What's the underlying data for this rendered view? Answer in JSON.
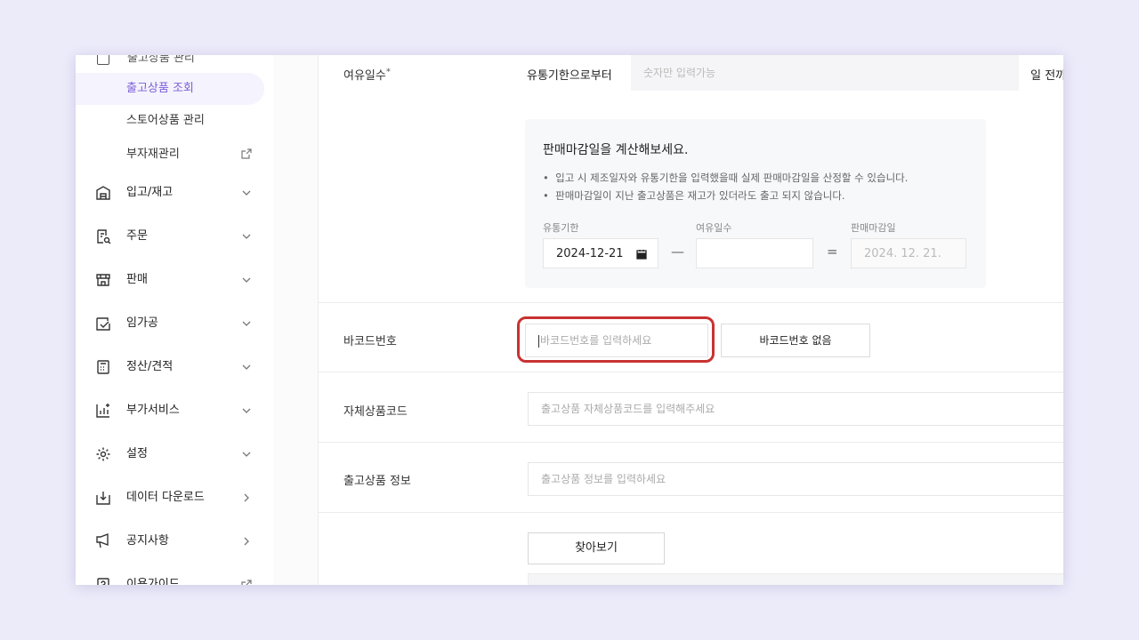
{
  "sidebar": {
    "top_cut_label": "출고상품 관리",
    "sub_items": [
      {
        "label": "출고상품 조회",
        "active": true
      },
      {
        "label": "스토어상품 관리"
      },
      {
        "label": "부자재관리",
        "external": true
      }
    ],
    "nav_items": [
      {
        "label": "입고/재고",
        "icon": "warehouse-icon",
        "chevron": "down"
      },
      {
        "label": "주문",
        "icon": "order-search-icon",
        "chevron": "down"
      },
      {
        "label": "판매",
        "icon": "store-icon",
        "chevron": "down"
      },
      {
        "label": "임가공",
        "icon": "processing-icon",
        "chevron": "down"
      },
      {
        "label": "정산/견적",
        "icon": "calculator-icon",
        "chevron": "down"
      },
      {
        "label": "부가서비스",
        "icon": "chart-plus-icon",
        "chevron": "down"
      },
      {
        "label": "설정",
        "icon": "gear-icon",
        "chevron": "down"
      },
      {
        "label": "데이터 다운로드",
        "icon": "download-icon",
        "chevron": "right"
      },
      {
        "label": "공지사항",
        "icon": "megaphone-icon",
        "chevron": "right"
      },
      {
        "label": "이용가이드",
        "icon": "guide-icon",
        "external": true
      }
    ]
  },
  "form": {
    "spare_days": {
      "label": "여유일수",
      "required_mark": "*",
      "from_label": "유통기한으로부터",
      "placeholder": "숫자만 입력가능",
      "after_text": "일 전까"
    },
    "calc": {
      "title": "판매마감일을 계산해보세요.",
      "bullets": [
        "입고 시 제조일자와 유통기한을 입력했을때 실제 판매마감일을 산정할 수 있습니다.",
        "판매마감일이 지난 출고상품은 재고가 있더라도 출고 되지 않습니다."
      ],
      "expiry_label": "유통기한",
      "expiry_value": "2024-12-21",
      "spare_label": "여유일수",
      "minus": "—",
      "equals": "=",
      "deadline_label": "판매마감일",
      "deadline_value": "2024. 12. 21."
    },
    "barcode": {
      "label": "바코드번호",
      "placeholder": "바코드번호를 입력하세요",
      "no_barcode_button": "바코드번호 없음"
    },
    "own_code": {
      "label": "자체상품코드",
      "placeholder": "출고상품 자체상품코드를 입력해주세요"
    },
    "product_info": {
      "label": "출고상품 정보",
      "placeholder": "출고상품 정보를 입력하세요"
    },
    "browse_button": "찾아보기"
  },
  "colors": {
    "accent": "#7b5fd9",
    "highlight_ring": "#c83232",
    "background": "#ecebfa"
  }
}
